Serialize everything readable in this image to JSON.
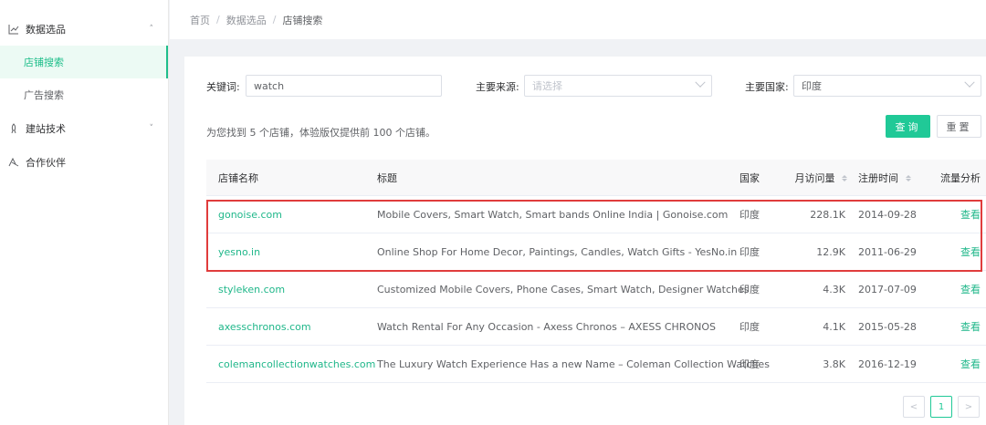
{
  "sidebar": {
    "groups": [
      {
        "label": "数据选品",
        "icon": "chart-icon",
        "chevron": "˄"
      },
      {
        "label": "建站技术",
        "icon": "rocket-icon",
        "chevron": "˅"
      },
      {
        "label": "合作伙伴",
        "icon": "partner-icon",
        "chevron": ""
      }
    ],
    "subitems": [
      {
        "label": "店铺搜索",
        "active": true
      },
      {
        "label": "广告搜索",
        "active": false
      }
    ]
  },
  "breadcrumb": {
    "home": "首页",
    "sep": "/",
    "level2": "数据选品",
    "current": "店铺搜索"
  },
  "filters": {
    "keyword_label": "关键词:",
    "keyword_value": "watch",
    "source_label": "主要来源:",
    "source_placeholder": "请选择",
    "country_label": "主要国家:",
    "country_value": "印度"
  },
  "result_text": "为您找到 5 个店铺，体验版仅提供前 100 个店铺。",
  "buttons": {
    "query": "查询",
    "reset": "重置"
  },
  "table": {
    "headers": {
      "name": "店铺名称",
      "title": "标题",
      "country": "国家",
      "visits": "月访问量",
      "date": "注册时间",
      "flow": "流量分析"
    },
    "rows": [
      {
        "name": "gonoise.com",
        "title": "Mobile Covers, Smart Watch, Smart bands Online India | Gonoise.com",
        "country": "印度",
        "visits": "228.1K",
        "date": "2014-09-28",
        "flow": "查看"
      },
      {
        "name": "yesno.in",
        "title": "Online Shop For Home Decor, Paintings, Candles, Watch Gifts - YesNo.in",
        "country": "印度",
        "visits": "12.9K",
        "date": "2011-06-29",
        "flow": "查看"
      },
      {
        "name": "styleken.com",
        "title": "Customized Mobile Covers, Phone Cases, Smart Watch, Designer Watches",
        "country": "印度",
        "visits": "4.3K",
        "date": "2017-07-09",
        "flow": "查看"
      },
      {
        "name": "axesschronos.com",
        "title": "Watch Rental For Any Occasion - Axess Chronos – AXESS CHRONOS",
        "country": "印度",
        "visits": "4.1K",
        "date": "2015-05-28",
        "flow": "查看"
      },
      {
        "name": "colemancollectionwatches.com",
        "title": "The Luxury Watch Experience Has a new Name – Coleman Collection Watches",
        "country": "印度",
        "visits": "3.8K",
        "date": "2016-12-19",
        "flow": "查看"
      }
    ]
  },
  "pagination": {
    "prev": "<",
    "current": "1",
    "next": ">"
  },
  "colors": {
    "accent": "#20c997",
    "highlight": "#e03c3c"
  }
}
